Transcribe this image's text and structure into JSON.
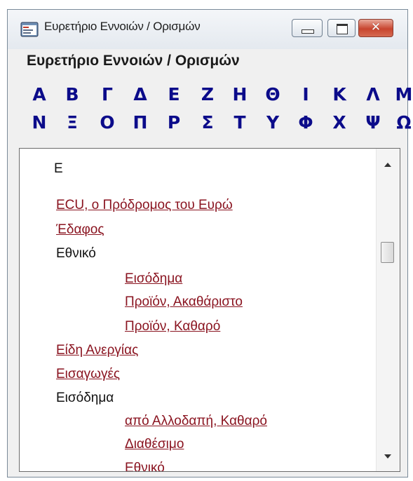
{
  "window": {
    "title": "Ευρετήριο Εννοιών / Ορισμών",
    "close_glyph": "✕"
  },
  "heading": "Ευρετήριο Εννοιών / Ορισμών",
  "alphabet": {
    "row1": [
      "Α",
      "Β",
      "Γ",
      "Δ",
      "Ε",
      "Ζ",
      "Η",
      "Θ",
      "Ι",
      "Κ",
      "Λ",
      "Μ"
    ],
    "row2": [
      "Ν",
      "Ξ",
      "Ο",
      "Π",
      "Ρ",
      "Σ",
      "Τ",
      "Υ",
      "Φ",
      "Χ",
      "Ψ",
      "Ω"
    ]
  },
  "colors": {
    "letter": "#0b0b8a",
    "link": "#8a1420",
    "text": "#111111"
  },
  "list": {
    "section_letter": "Ε",
    "items": [
      {
        "text": "ECU, ο Πρόδρομος του Ευρώ ",
        "link": true,
        "indent": 0
      },
      {
        "text": "Έδαφος",
        "link": true,
        "indent": 0
      },
      {
        "text": "Εθνικό",
        "link": false,
        "indent": 0
      },
      {
        "text": "Εισόδημα",
        "link": true,
        "indent": 1
      },
      {
        "text": "Προϊόν, Ακαθάριστο",
        "link": true,
        "indent": 1
      },
      {
        "text": "Προϊόν, Καθαρό",
        "link": true,
        "indent": 1
      },
      {
        "text": "Είδη Ανεργίας",
        "link": true,
        "indent": 0
      },
      {
        "text": "Εισαγωγές",
        "link": true,
        "indent": 0
      },
      {
        "text": "Εισόδημα",
        "link": false,
        "indent": 0
      },
      {
        "text": "από Αλλοδαπή, Καθαρό",
        "link": true,
        "indent": 1
      },
      {
        "text": "Διαθέσιμο",
        "link": true,
        "indent": 1
      },
      {
        "text": "Εθνικό",
        "link": true,
        "indent": 1
      }
    ]
  },
  "icons": {
    "app": "window-index-icon",
    "minimize": "minimize-icon",
    "maximize": "maximize-icon",
    "close": "close-icon",
    "scroll_up": "scroll-up-arrow-icon",
    "scroll_down": "scroll-down-arrow-icon"
  }
}
